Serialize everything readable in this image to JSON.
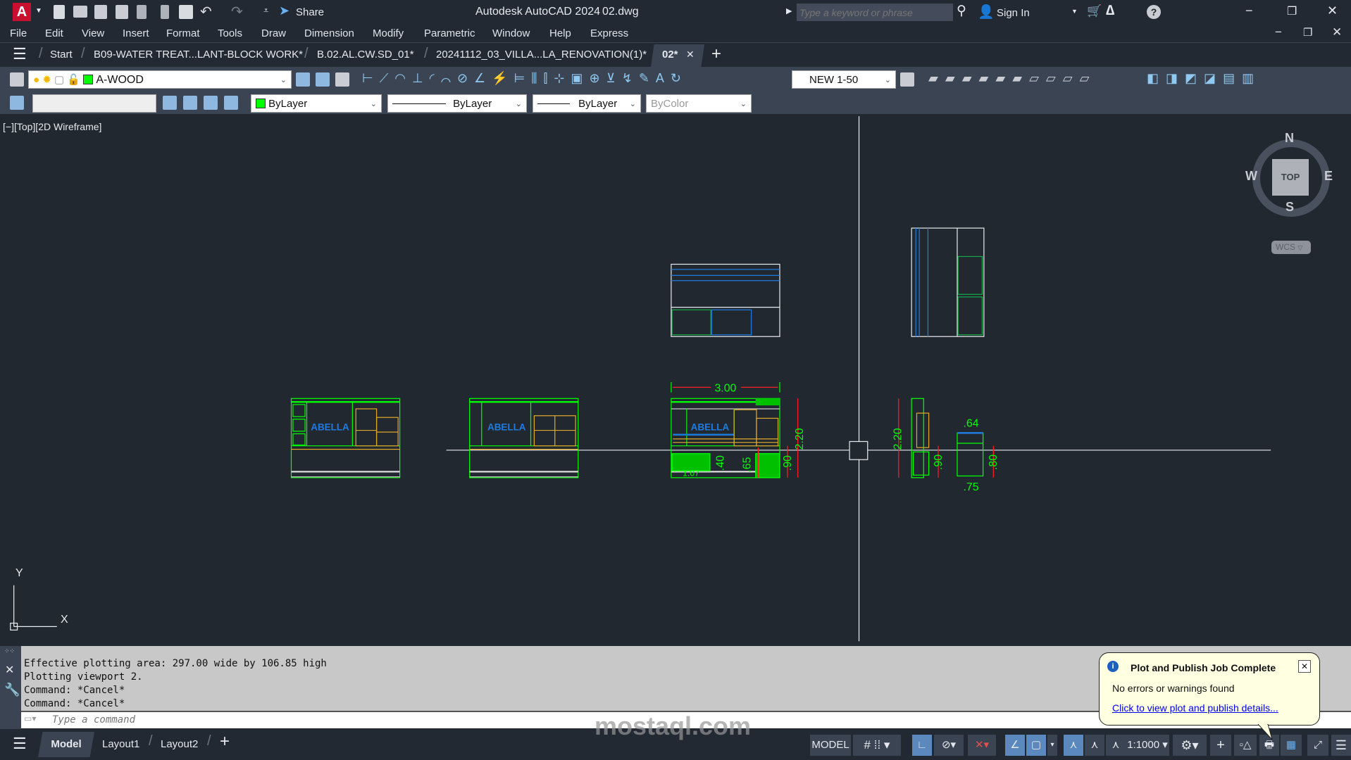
{
  "app": {
    "title": "Autodesk AutoCAD 2024",
    "file": "02.dwg",
    "logo": "A",
    "share": "Share",
    "search_placeholder": "Type a keyword or phrase",
    "sign_in": "Sign In"
  },
  "menu": [
    "File",
    "Edit",
    "View",
    "Insert",
    "Format",
    "Tools",
    "Draw",
    "Dimension",
    "Modify",
    "Parametric",
    "Window",
    "Help",
    "Express"
  ],
  "tabs": [
    {
      "label": "Start"
    },
    {
      "label": "B09-WATER TREAT...LANT-BLOCK WORK*"
    },
    {
      "label": "B.02.AL.CW.SD_01*"
    },
    {
      "label": "20241112_03_VILLA...LA_RENOVATION(1)*"
    },
    {
      "label": "02*",
      "active": true
    }
  ],
  "toolbar": {
    "layer": "A-WOOD",
    "layer_color": "#00ff00",
    "dimstyle": "NEW 1-50",
    "color": "ByLayer",
    "linetype": "ByLayer",
    "lineweight": "ByLayer",
    "plotstyle": "ByColor"
  },
  "viewport": {
    "label": "[−][Top][2D Wireframe]",
    "viewcube": {
      "face": "TOP",
      "n": "N",
      "s": "S",
      "e": "E",
      "w": "W",
      "ucs": "WCS"
    },
    "ucs_x": "X",
    "ucs_y": "Y"
  },
  "drawing": {
    "logo": "ABELLA",
    "dims": {
      "width": "3.00",
      "h220": "2.20",
      "h90": ".90",
      "h65": ".65",
      "h40": ".40",
      "w107": "1.07",
      "side_h220": "2.20",
      "side_h90": ".90",
      "w64": ".64",
      "h80": ".80",
      "w75": ".75"
    }
  },
  "command": {
    "history": [
      "Effective plotting area:  297.00 wide by 106.85 high",
      "Plotting viewport 2.",
      "Command: *Cancel*",
      "Command: *Cancel*"
    ],
    "placeholder": "Type a command"
  },
  "layouts": [
    "Model",
    "Layout1",
    "Layout2"
  ],
  "status": {
    "model": "MODEL",
    "scale": "1:1000"
  },
  "notification": {
    "title": "Plot and Publish Job Complete",
    "message": "No errors or warnings found",
    "link": "Click to view plot and publish details..."
  },
  "watermark": "mostaql.com",
  "colors": {
    "accent": "#5b88bd",
    "green": "#00ff00",
    "blue": "#1e7be0",
    "yellow": "#e0a82a",
    "red": "#ff2020"
  }
}
